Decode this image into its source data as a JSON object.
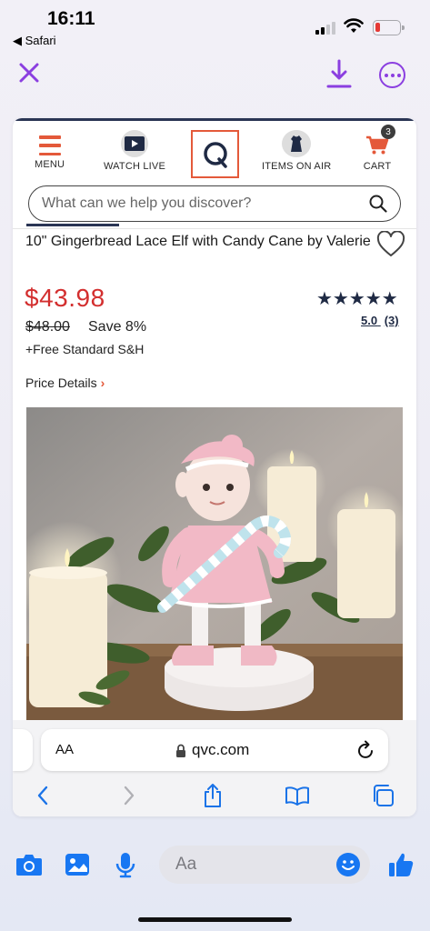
{
  "status_bar": {
    "time": "16:11",
    "back_app": "◀ Safari"
  },
  "viewer": {
    "close_icon": "close-icon",
    "download_icon": "download-icon",
    "more_icon": "more-icon",
    "accent": "#8b3fe0"
  },
  "qvc_nav": {
    "menu_label": "MENU",
    "watch_label": "WATCH LIVE",
    "items_label": "ITEMS ON AIR",
    "cart_label": "CART",
    "cart_count": "3",
    "brand_color": "#e4593a"
  },
  "search": {
    "placeholder": "What can we help you discover?"
  },
  "product": {
    "title": "10\" Gingerbread Lace Elf with Candy Cane by Valerie",
    "price": "$43.98",
    "old_price": "$48.00",
    "save": "Save 8%",
    "shipping": "+Free Standard S&H",
    "price_details": "Price Details",
    "stars": "★★★★★",
    "rating": "5.0",
    "review_count": "(3)"
  },
  "safari": {
    "aa_label": "AA",
    "url": "qvc.com"
  },
  "composer": {
    "placeholder": "Aa",
    "accent": "#1877f2"
  }
}
